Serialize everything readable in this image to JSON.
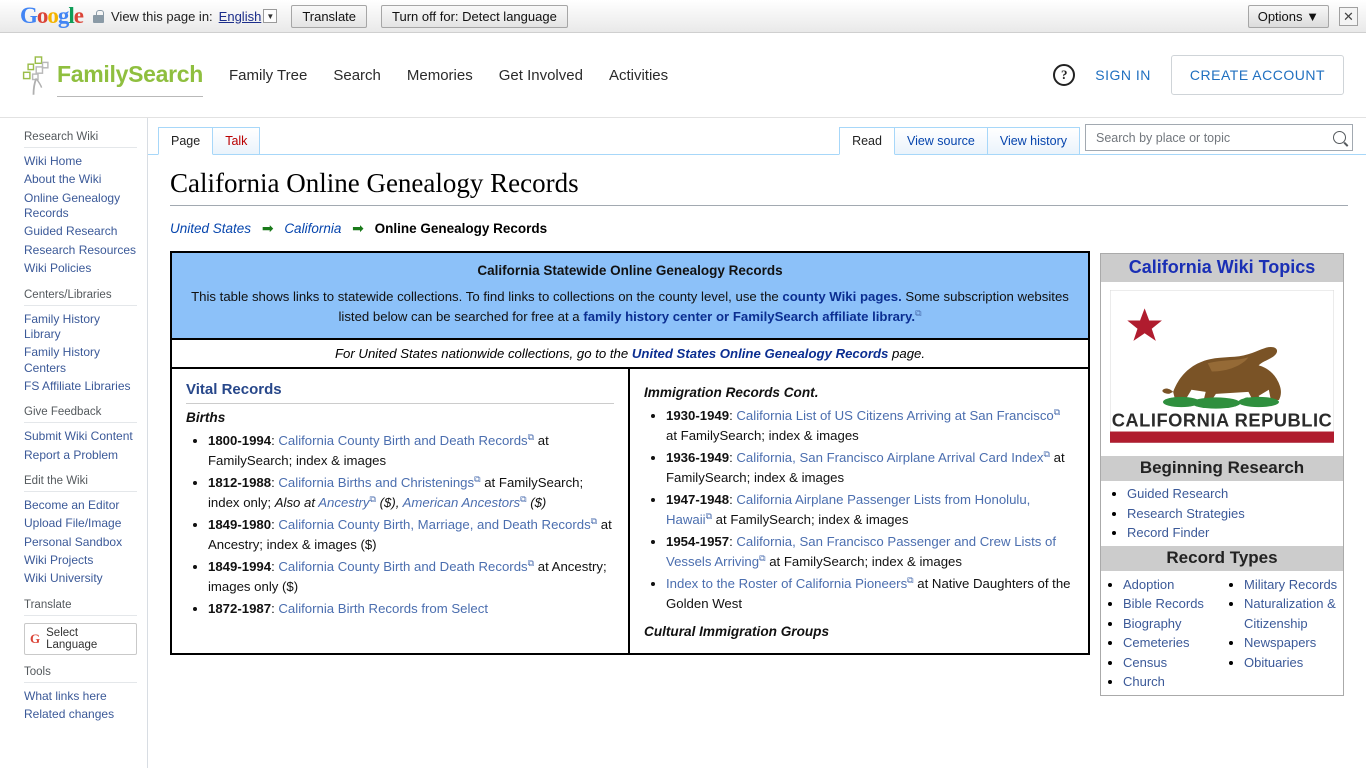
{
  "translate_bar": {
    "logo": [
      "G",
      "o",
      "o",
      "g",
      "l",
      "e"
    ],
    "lock_icon": "lock-icon",
    "view_label": "View this page in:",
    "language": "English",
    "translate_button": "Translate",
    "turn_off_button": "Turn off for: Detect language",
    "options_button": "Options ▼",
    "close_icon": "✕"
  },
  "header": {
    "logo_text": "FamilySearch",
    "logo_icon": "family-tree-icon",
    "nav": [
      {
        "label": "Family Tree"
      },
      {
        "label": "Search"
      },
      {
        "label": "Memories"
      },
      {
        "label": "Get Involved"
      },
      {
        "label": "Activities"
      }
    ],
    "help_icon": "?",
    "sign_in": "SIGN IN",
    "create_account": "CREATE ACCOUNT"
  },
  "sidebar": {
    "groups": [
      {
        "heading": "Research Wiki",
        "items": [
          "Wiki Home",
          "About the Wiki",
          "Online Genealogy Records",
          "Guided Research",
          "Research Resources",
          "Wiki Policies"
        ]
      },
      {
        "heading": "Centers/Libraries",
        "items": [
          "Family History Library",
          "Family History Centers",
          "FS Affiliate Libraries"
        ]
      },
      {
        "heading": "Give Feedback",
        "items": [
          "Submit Wiki Content",
          "Report a Problem"
        ]
      },
      {
        "heading": "Edit the Wiki",
        "items": [
          "Become an Editor",
          "Upload File/Image",
          "Personal Sandbox",
          "Wiki Projects",
          "Wiki University"
        ]
      }
    ],
    "translate_heading": "Translate",
    "select_language": "Select Language",
    "tools_heading": "Tools",
    "tools_items": [
      "What links here",
      "Related changes"
    ]
  },
  "tabs": {
    "left": [
      {
        "label": "Page",
        "active": true
      },
      {
        "label": "Talk",
        "active": false
      }
    ],
    "right": [
      {
        "label": "Read",
        "active": true
      },
      {
        "label": "View source",
        "active": false
      },
      {
        "label": "View history",
        "active": false
      }
    ]
  },
  "search": {
    "placeholder": "Search by place or topic",
    "icon": "search-icon",
    "value": ""
  },
  "page": {
    "title": "California Online Genealogy Records",
    "breadcrumb": [
      {
        "label": "United States",
        "link": true
      },
      {
        "label": "California",
        "link": true
      },
      {
        "label": "Online Genealogy Records",
        "link": false
      }
    ],
    "arrow": "➡"
  },
  "statewide_box": {
    "title": "California Statewide Online Genealogy Records",
    "body_1": "This table shows links to statewide collections. To find links to collections on the county level, use the ",
    "link_1": "county Wiki pages.",
    "body_2": " Some subscription websites listed below can be searched for free at a ",
    "link_2": "family history center or FamilySearch affiliate library.",
    "nationwide_pre": "For United States nationwide collections, go to the ",
    "nationwide_link": "United States Online Genealogy Records",
    "nationwide_post": " page."
  },
  "left_column": {
    "heading": "Vital Records",
    "subheading": "Births",
    "items": [
      {
        "years": "1800-1994",
        "sep": ": ",
        "link": "California County Birth and Death Records",
        "after": " at FamilySearch; index & images"
      },
      {
        "years": "1812-1988",
        "sep": ": ",
        "link": "California Births and Christenings",
        "after": " at FamilySearch; index only; ",
        "italic_after": "Also at ",
        "link2": "Ancestry",
        "tail2": " ($), ",
        "link3": "American Ancestors",
        "tail3": " ($)"
      },
      {
        "years": "1849-1980",
        "sep": ": ",
        "link": "California County Birth, Marriage, and Death Records",
        "after": " at Ancestry; index & images ($)"
      },
      {
        "years": "1849-1994",
        "sep": ": ",
        "link": "California County Birth and Death Records",
        "after": " at Ancestry; images only ($)"
      },
      {
        "years": "1872-1987",
        "sep": ": ",
        "link": "California Birth Records from Select",
        "after": ""
      }
    ]
  },
  "right_column": {
    "heading": "Immigration Records Cont.",
    "items": [
      {
        "years": "1930-1949",
        "sep": ": ",
        "link": "California List of US Citizens Arriving at San Francisco",
        "after": " at FamilySearch; index & images"
      },
      {
        "years": "1936-1949",
        "sep": ": ",
        "link": "California, San Francisco Airplane Arrival Card Index",
        "after": " at FamilySearch; index & images"
      },
      {
        "years": "1947-1948",
        "sep": ": ",
        "link": "California Airplane Passenger Lists from Honolulu, Hawaii",
        "after": " at FamilySearch; index & images"
      },
      {
        "years": "1954-1957",
        "sep": ": ",
        "link": "California, San Francisco Passenger and Crew Lists of Vessels Arriving",
        "after": " at FamilySearch; index & images"
      },
      {
        "years": "",
        "sep": "",
        "link": "Index to the Roster of California Pioneers",
        "after": " at Native Daughters of the Golden West"
      }
    ],
    "footer_heading": "Cultural Immigration Groups"
  },
  "infobox": {
    "title": "California Wiki Topics",
    "flag_alt": "california-state-flag",
    "flag_caption": "CALIFORNIA REPUBLIC",
    "sections": [
      {
        "heading": "Beginning Research",
        "items": [
          "Guided Research",
          "Research Strategies",
          "Record Finder"
        ],
        "two_column": false
      },
      {
        "heading": "Record Types",
        "column_left": [
          "Adoption",
          "Bible Records",
          "Biography",
          "Cemeteries",
          "Census",
          "Church"
        ],
        "column_right": [
          "Military Records",
          "Naturalization & Citizenship",
          "Newspapers",
          "Obituaries"
        ],
        "two_column": true
      }
    ]
  },
  "colors": {
    "blue_box": "#8cc1f9",
    "link": "#0645ad",
    "wiki_link": "#3b5998",
    "accent_green": "#8fbf3f",
    "infobox_header": "#cccccc",
    "infobox_title_text": "#1a2fb5",
    "flag_red": "#b01c2e"
  }
}
